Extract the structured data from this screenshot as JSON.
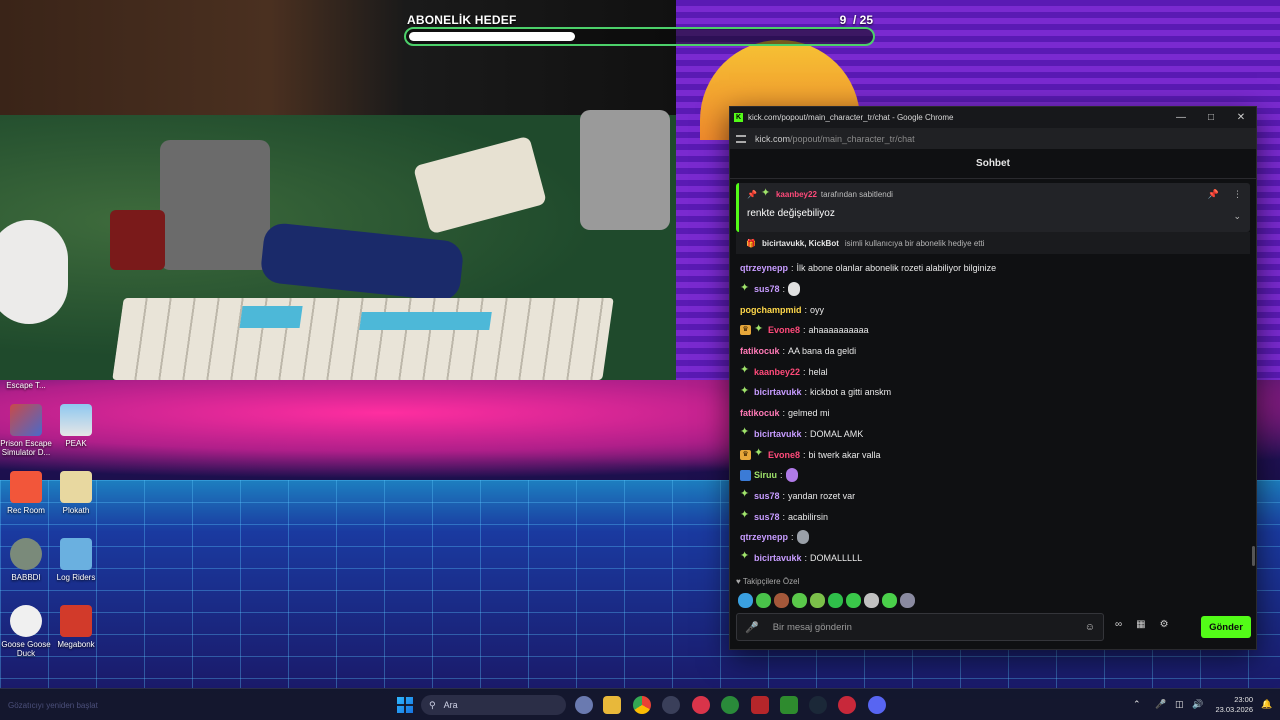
{
  "stream_overlay": {
    "goal_label": "ABONELİK HEDEF",
    "goal_current": 9,
    "goal_total": 25,
    "goal_count_text": "9  / 25",
    "goal_progress": 0.36,
    "goal_bar_color": "#4cd06a"
  },
  "desktop_icons": [
    {
      "label": "Escape T..."
    },
    {
      "label": "Prison Escape Simulator D..."
    },
    {
      "label": "PEAK"
    },
    {
      "label": "Rec Room"
    },
    {
      "label": "Plokath"
    },
    {
      "label": "BABBDI"
    },
    {
      "label": "Log Riders"
    },
    {
      "label": "Goose Goose Duck"
    },
    {
      "label": "Megabonk"
    }
  ],
  "browser": {
    "window_title": "kick.com/popout/main_character_tr/chat - Google Chrome",
    "url_host": "kick.com",
    "url_path": "/popout/main_character_tr/chat",
    "accent": "#53fc18"
  },
  "chat": {
    "header": "Sohbet",
    "pinned": {
      "by_user": "kaanbey22",
      "by_text": "tarafından sabitlendi",
      "message": "renkte değişebiliyoz"
    },
    "gift": {
      "users": "bicirtavukk, KickBot",
      "text": "isimli kullanıcıya bir abonelik hediye etti"
    },
    "messages": [
      {
        "badges": [],
        "user": "qtrzeynepp",
        "color": "#c79cff",
        "text": "İlk abone olanlar abonelik rozeti alabiliyor bilginize"
      },
      {
        "badges": [
          "sub"
        ],
        "user": "sus78",
        "color": "#c79cff",
        "text": "",
        "emote": "ghost-emote"
      },
      {
        "badges": [],
        "user": "pogchampmid",
        "color": "#ffd84a",
        "text": "oyy"
      },
      {
        "badges": [
          "crown",
          "sub"
        ],
        "user": "Evone8",
        "color": "#ff4a7a",
        "text": "ahaaaaaaaaaa"
      },
      {
        "badges": [],
        "user": "fatikocuk",
        "color": "#ff7ab6",
        "text": "AA bana da geldi"
      },
      {
        "badges": [
          "sub"
        ],
        "user": "kaanbey22",
        "color": "#ff4a7a",
        "text": "helal"
      },
      {
        "badges": [
          "sub"
        ],
        "user": "bicirtavukk",
        "color": "#c79cff",
        "text": "kickbot a gitti anskm"
      },
      {
        "badges": [],
        "user": "fatikocuk",
        "color": "#ff7ab6",
        "text": "gelmed mi"
      },
      {
        "badges": [
          "sub"
        ],
        "user": "bicirtavukk",
        "color": "#c79cff",
        "text": "DOMAL AMK"
      },
      {
        "badges": [
          "crown",
          "sub"
        ],
        "user": "Evone8",
        "color": "#ff4a7a",
        "text": "bi twerk akar valla"
      },
      {
        "badges": [
          "pro"
        ],
        "user": "Siruu",
        "color": "#9fe36a",
        "text": "",
        "emote": "dance-emote"
      },
      {
        "badges": [
          "sub"
        ],
        "user": "sus78",
        "color": "#c79cff",
        "text": "yandan rozet var"
      },
      {
        "badges": [
          "sub"
        ],
        "user": "sus78",
        "color": "#c79cff",
        "text": "acabilirsin"
      },
      {
        "badges": [],
        "user": "qtrzeynepp",
        "color": "#c79cff",
        "text": "",
        "emote": "statue-emote"
      },
      {
        "badges": [
          "sub"
        ],
        "user": "bicirtavukk",
        "color": "#c79cff",
        "text": "DOMALLLLL"
      }
    ],
    "follower_only": "Takipçilere Özel",
    "composer_placeholder": "Bir mesaj gönderin",
    "send_label": "Gönder"
  },
  "taskbar": {
    "ghost_text": "Gözatıcıyı yeniden başlat",
    "search_placeholder": "Ara",
    "time": "23:00",
    "date": "23.03.2026"
  }
}
